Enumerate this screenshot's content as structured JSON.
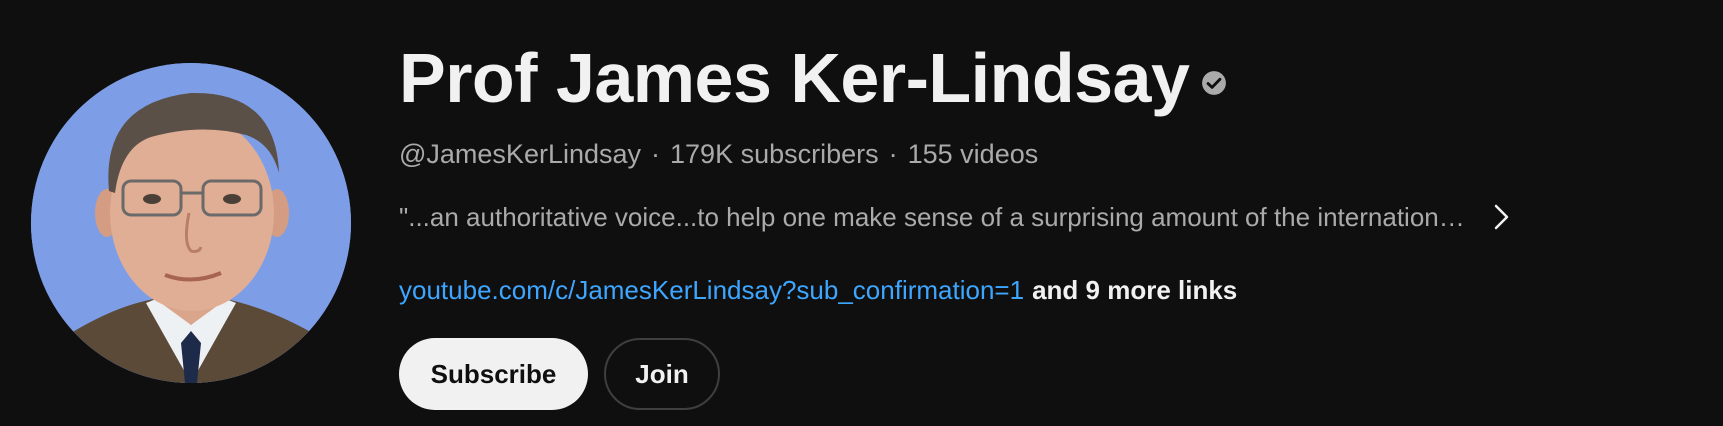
{
  "channel": {
    "name": "Prof James Ker-Lindsay",
    "verified_icon": "verified-check-icon",
    "handle": "@JamesKerLindsay",
    "separator": "·",
    "subscribers": "179K subscribers",
    "videos": "155 videos",
    "description": "\"...an authoritative voice...to help one make sense of a surprising amount of the internation…",
    "link_text": "youtube.com/c/JamesKerLindsay?sub_confirmation=1",
    "more_links": "and 9 more links"
  },
  "buttons": {
    "subscribe_label": "Subscribe",
    "join_label": "Join"
  },
  "colors": {
    "background": "#0f0f0f",
    "primary_text": "#f1f1f1",
    "secondary_text": "#aaaaaa",
    "link": "#3ea6ff",
    "avatar_background": "#7d9ee6"
  },
  "icons": {
    "expand_description": "chevron-right-icon"
  }
}
